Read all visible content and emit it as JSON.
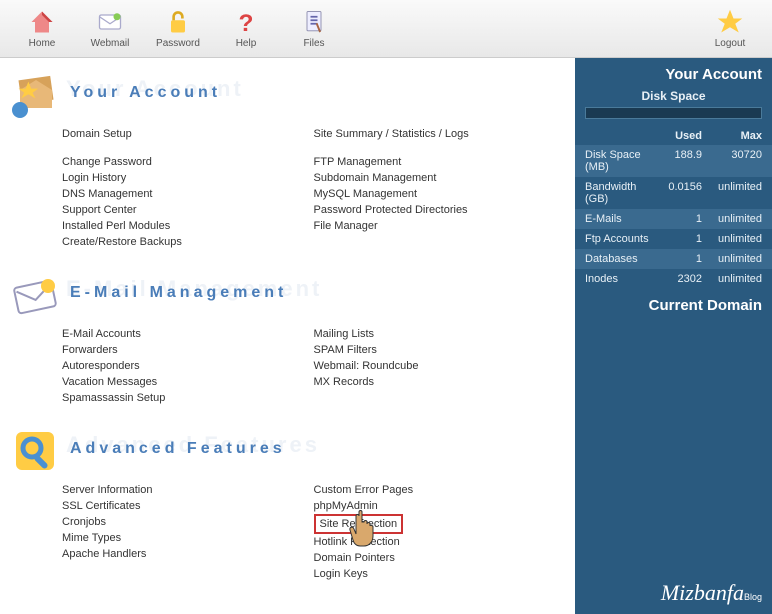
{
  "toolbar": {
    "home": "Home",
    "webmail": "Webmail",
    "password": "Password",
    "help": "Help",
    "files": "Files",
    "logout": "Logout"
  },
  "sections": {
    "account": {
      "title": "Your Account",
      "bg": "Your Account",
      "left": [
        "Domain Setup",
        "",
        "Change Password",
        "Login History",
        "DNS Management",
        "Support Center",
        "Installed Perl Modules",
        "Create/Restore Backups"
      ],
      "right": [
        "Site Summary / Statistics / Logs",
        "",
        "FTP Management",
        "Subdomain Management",
        "MySQL Management",
        "Password Protected Directories",
        "File Manager"
      ]
    },
    "email": {
      "title": "E-Mail Management",
      "bg": "E-Mail Management",
      "left": [
        "E-Mail Accounts",
        "Forwarders",
        "Autoresponders",
        "Vacation Messages",
        "Spamassassin Setup"
      ],
      "right": [
        "Mailing Lists",
        "SPAM Filters",
        "Webmail: Roundcube",
        "MX Records"
      ]
    },
    "advanced": {
      "title": "Advanced Features",
      "bg": "Advanced Features",
      "left": [
        "Server Information",
        "SSL Certificates",
        "Cronjobs",
        "Mime Types",
        "Apache Handlers"
      ],
      "right_pre": [
        "Custom Error Pages",
        "phpMyAdmin"
      ],
      "highlight": "Site Redirection",
      "right_post": [
        "Hotlink Protection",
        "Domain Pointers",
        "Login Keys"
      ]
    }
  },
  "sidebar": {
    "title": "Your Account",
    "disk_space": "Disk Space",
    "head_used": "Used",
    "head_max": "Max",
    "stats": [
      {
        "label": "Disk Space (MB)",
        "used": "188.9",
        "max": "30720"
      },
      {
        "label": "Bandwidth (GB)",
        "used": "0.0156",
        "max": "unlimited"
      },
      {
        "label": "E-Mails",
        "used": "1",
        "max": "unlimited"
      },
      {
        "label": "Ftp Accounts",
        "used": "1",
        "max": "unlimited"
      },
      {
        "label": "Databases",
        "used": "1",
        "max": "unlimited"
      },
      {
        "label": "Inodes",
        "used": "2302",
        "max": "unlimited"
      }
    ],
    "current_domain": "Current Domain",
    "logo": "Mizbanfa",
    "blog": "Blog"
  }
}
